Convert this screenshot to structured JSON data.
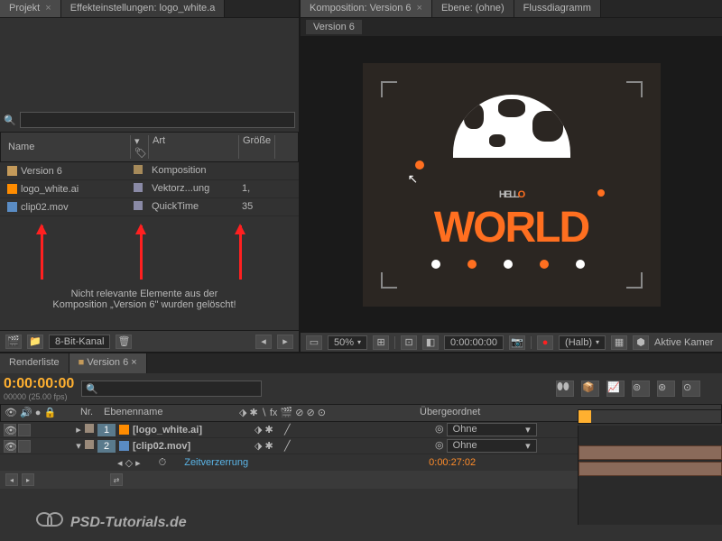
{
  "tabs_top_left": [
    {
      "label": "Projekt",
      "active": true
    },
    {
      "label": "Effekteinstellungen: logo_white.a",
      "active": false
    }
  ],
  "tabs_top_right": [
    {
      "label": "Komposition: Version 6",
      "active": true
    },
    {
      "label": "Ebene: (ohne)",
      "active": false
    },
    {
      "label": "Flussdiagramm",
      "active": false
    }
  ],
  "comp_breadcrumb": "Version 6",
  "search_placeholder": "",
  "search_icon": "🔍",
  "project_headers": {
    "name": "Name",
    "tag": "",
    "type": "Art",
    "size": "Größe"
  },
  "project_items": [
    {
      "icon": "comp",
      "name": "Version 6",
      "color": "#a68a5a",
      "type": "Komposition",
      "size": ""
    },
    {
      "icon": "ai",
      "name": "logo_white.ai",
      "color": "#8a8aa6",
      "type": "Vektorz...ung",
      "size": "1,"
    },
    {
      "icon": "mov",
      "name": "clip02.mov",
      "color": "#8a8aa6",
      "type": "QuickTime",
      "size": "35"
    }
  ],
  "annotation": {
    "line1": "Nicht relevante Elemente aus der",
    "line2": "Komposition „Version 6\" wurden gelöscht!"
  },
  "bitdepth": "8-Bit-Kanal",
  "viewer": {
    "zoom": "50%",
    "timecode": "0:00:00:00",
    "quality": "(Halb)",
    "camera": "Aktive Kamer"
  },
  "timeline": {
    "tabs": [
      {
        "label": "Renderliste",
        "active": false
      },
      {
        "label": "Version 6",
        "active": true
      }
    ],
    "timecode": "0:00:00:00",
    "timecode_color": "#ffb030",
    "fps_text": "00000 (25.00 fps)",
    "headers": {
      "num": "Nr.",
      "name": "Ebenenname",
      "switches_icons": "⬗ ✱ ∖ fx 🎬 ⊘ ⊘ ⊙",
      "parent": "Übergeordnet"
    },
    "layers": [
      {
        "num": "1",
        "name": "[logo_white.ai]",
        "icon": "ai",
        "parent": "Ohne"
      },
      {
        "num": "2",
        "name": "[clip02.mov]",
        "icon": "mov",
        "parent": "Ohne"
      }
    ],
    "time_remap": {
      "label": "Zeitverzerrung",
      "value": "0:00:27:02"
    }
  },
  "watermark": "PSD-Tutorials.de",
  "hello_text": "HELL",
  "hello_o": "O",
  "world_text": "WORLD"
}
